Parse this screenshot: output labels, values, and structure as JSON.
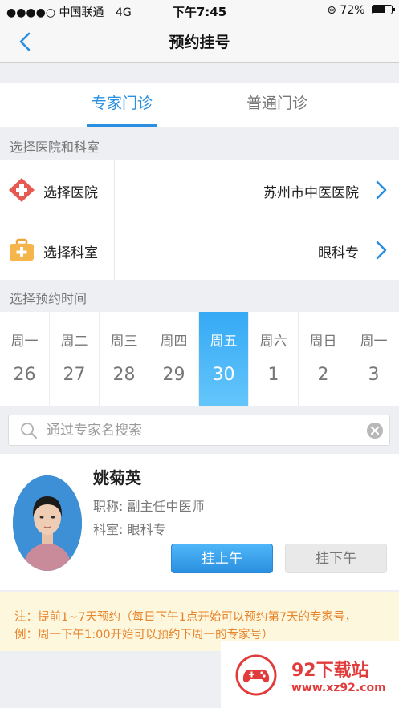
{
  "status": {
    "carrier": "●●●●○ 中国联通",
    "network": "4G",
    "time": "下午7:45",
    "battery": "72%",
    "battery_level": 0.72
  },
  "nav": {
    "title": "预约挂号"
  },
  "tabs": [
    {
      "label": "专家门诊",
      "active": true
    },
    {
      "label": "普通门诊",
      "active": false
    }
  ],
  "section_hospital": "选择医院和科室",
  "hospital_row": {
    "label": "选择医院",
    "value": "苏州市中医医院"
  },
  "dept_row": {
    "label": "选择科室",
    "value": "眼科专"
  },
  "section_time": "选择预约时间",
  "days": [
    {
      "weekday": "周一",
      "date": "26"
    },
    {
      "weekday": "周二",
      "date": "27"
    },
    {
      "weekday": "周三",
      "date": "28"
    },
    {
      "weekday": "周四",
      "date": "29"
    },
    {
      "weekday": "周五",
      "date": "30",
      "selected": true
    },
    {
      "weekday": "周六",
      "date": "1"
    },
    {
      "weekday": "周日",
      "date": "2"
    },
    {
      "weekday": "周一",
      "date": "3"
    }
  ],
  "search": {
    "placeholder": "通过专家名搜索",
    "value": ""
  },
  "doctor": {
    "name": "姚菊英",
    "title_line": "职称:  副主任中医师",
    "dept_line": "科室:  眼科专",
    "am_button": "挂上午",
    "pm_button": "挂下午"
  },
  "note": {
    "line1": "注：提前1~7天预约（每日下午1点开始可以预约第7天的专家号，",
    "line2": "例：周一下午1:00开始可以预约下周一的专家号）"
  },
  "watermark": {
    "title": "92下载站",
    "url": "www.xz92.com"
  },
  "colors": {
    "accent": "#2a8fe0",
    "note_text": "#e8842b",
    "note_bg": "#fdf7de",
    "watermark": "#e23b3b"
  }
}
